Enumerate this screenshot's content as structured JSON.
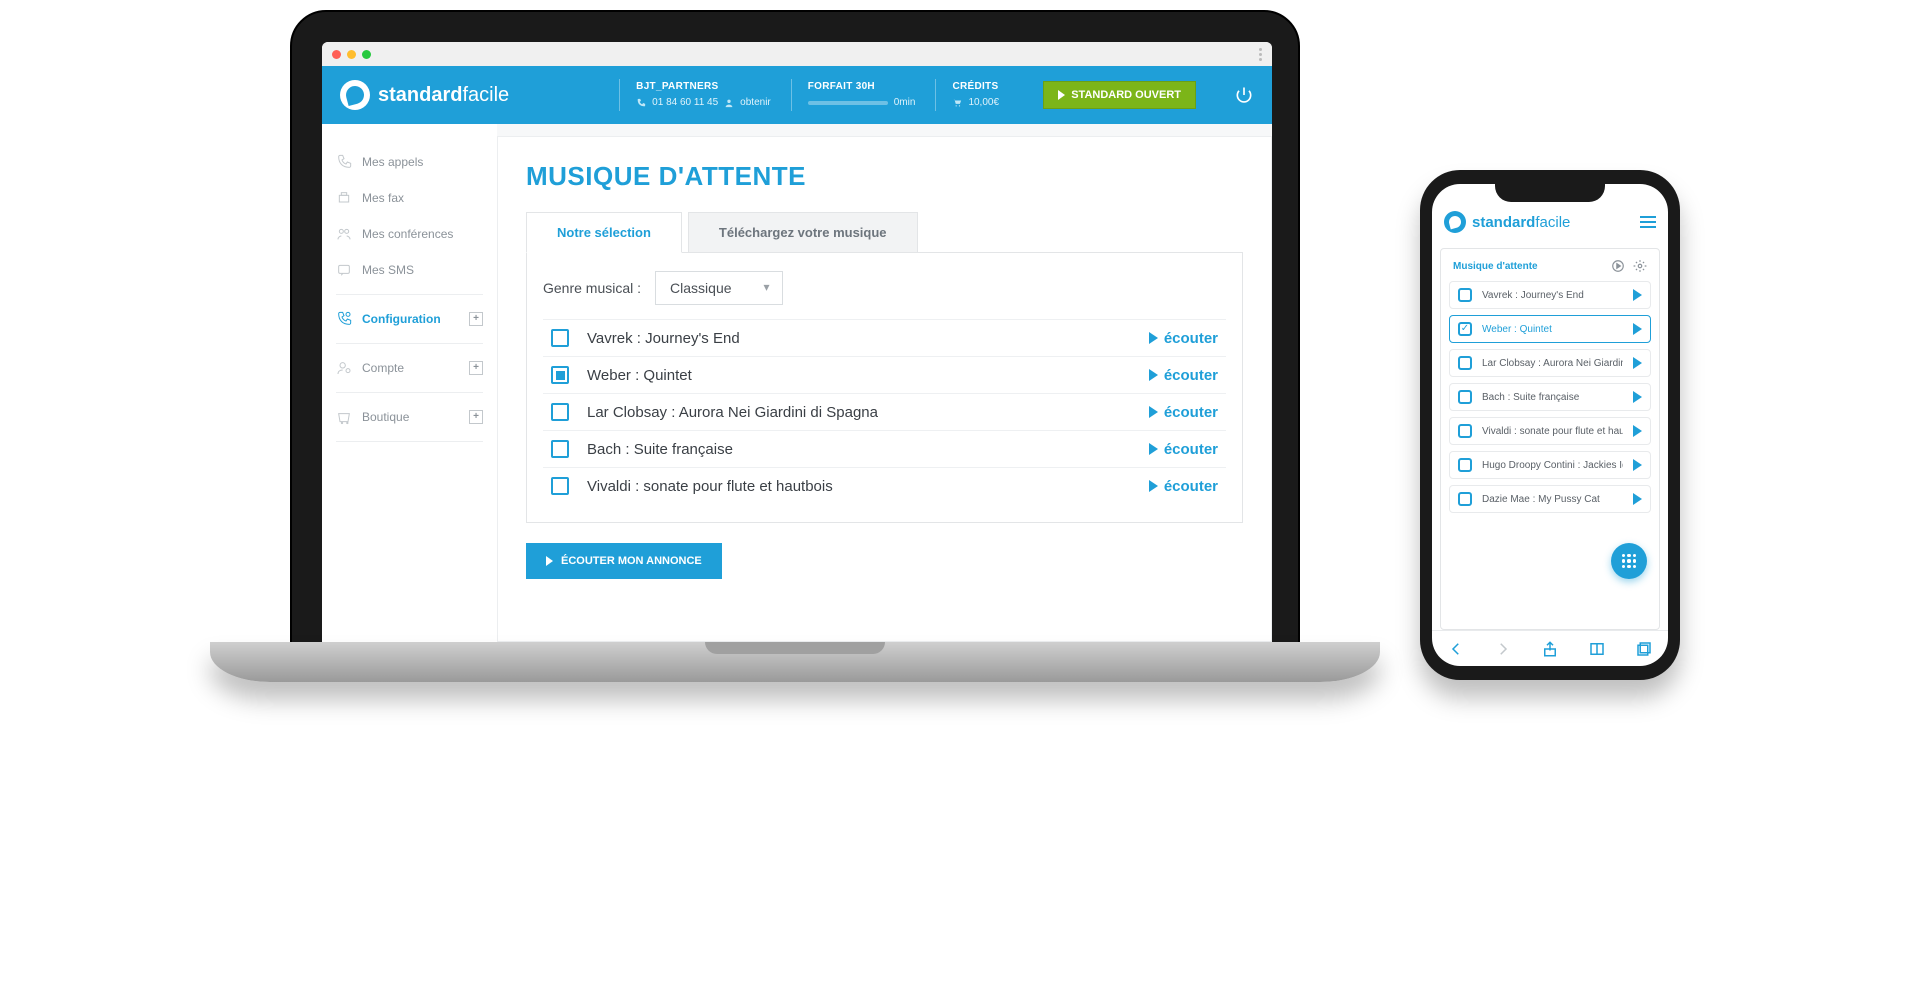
{
  "brand": {
    "name1": "standard",
    "name2": "facile"
  },
  "header": {
    "account": {
      "title": "BJT_PARTNERS",
      "phone": "01 84 60 11 45",
      "obtain": "obtenir"
    },
    "plan": {
      "title": "FORFAIT 30H",
      "value": "0min"
    },
    "credits": {
      "title": "CRÉDITS",
      "value": "10,00€"
    },
    "status_label": "STANDARD OUVERT"
  },
  "sidebar": {
    "items": [
      {
        "label": "Mes appels",
        "expand": false
      },
      {
        "label": "Mes fax",
        "expand": false
      },
      {
        "label": "Mes conférences",
        "expand": false
      },
      {
        "label": "Mes SMS",
        "expand": false
      },
      {
        "label": "Configuration",
        "expand": true,
        "active": true
      },
      {
        "label": "Compte",
        "expand": true
      },
      {
        "label": "Boutique",
        "expand": true
      }
    ]
  },
  "main": {
    "page_title": "MUSIQUE D'ATTENTE",
    "tabs": {
      "selection": "Notre sélection",
      "upload": "Téléchargez votre musique"
    },
    "genre_label": "Genre musical :",
    "genre_value": "Classique",
    "listen_label": "écouter",
    "tracks": [
      {
        "label": "Vavrek : Journey's End",
        "checked": false
      },
      {
        "label": "Weber : Quintet",
        "checked": true
      },
      {
        "label": "Lar Clobsay : Aurora Nei Giardini di Spagna",
        "checked": false
      },
      {
        "label": "Bach : Suite française",
        "checked": false
      },
      {
        "label": "Vivaldi : sonate pour flute et hautbois",
        "checked": false
      }
    ],
    "preview_btn": "ÉCOUTER MON ANNONCE"
  },
  "mobile": {
    "card_title": "Musique d'attente",
    "tracks": [
      {
        "label": "Vavrek : Journey's End",
        "checked": false
      },
      {
        "label": "Weber : Quintet",
        "checked": true
      },
      {
        "label": "Lar Clobsay : Aurora Nei Giardini di Spagna",
        "checked": false
      },
      {
        "label": "Bach : Suite française",
        "checked": false
      },
      {
        "label": "Vivaldi : sonate pour flute et hautbois",
        "checked": false
      },
      {
        "label": "Hugo Droopy Contini : Jackies Idea",
        "checked": false
      },
      {
        "label": "Dazie Mae : My Pussy Cat",
        "checked": false
      }
    ]
  }
}
